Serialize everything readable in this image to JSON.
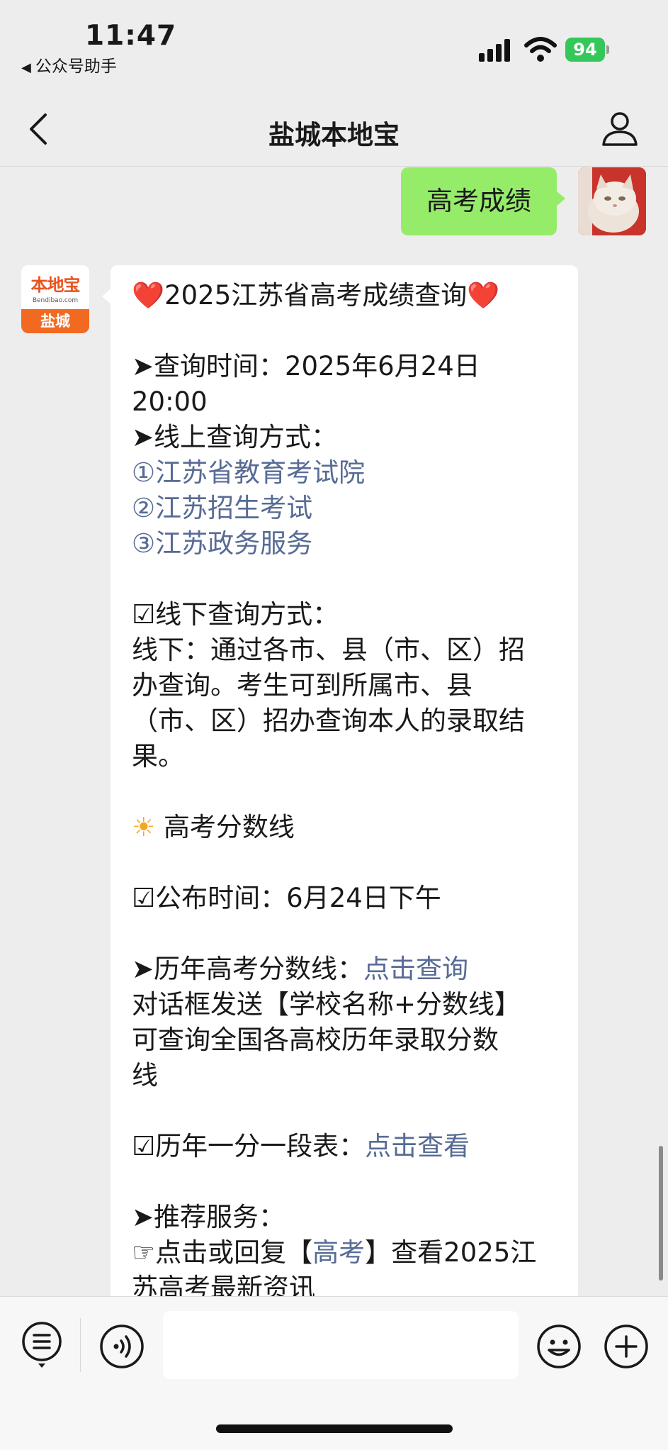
{
  "status_bar": {
    "time": "11:47",
    "back_app": "公众号助手",
    "battery": "94"
  },
  "nav": {
    "title": "盐城本地宝"
  },
  "sent_message": {
    "text": "高考成绩"
  },
  "sender": {
    "logo_text": "本地宝",
    "logo_url": "Bendibao.com",
    "logo_city": "盐城"
  },
  "message": {
    "title_heart_left": "❤️",
    "title": "2025江苏省高考成绩查询",
    "title_heart_right": "❤️",
    "query_time_label": "➤查询时间：2025年6月24日",
    "query_time_line2": "20:00",
    "online_label": "➤线上查询方式：",
    "online_links": [
      {
        "num": "①",
        "text": "江苏省教育考试院"
      },
      {
        "num": "②",
        "text": "江苏招生考试"
      },
      {
        "num": "③",
        "text": "江苏政务服务"
      }
    ],
    "offline_label": "☑线下查询方式：",
    "offline_lines": [
      "线下：通过各市、县（市、区）招",
      "办查询。考生可到所属市、县",
      "（市、区）招办查询本人的录取结",
      "果。"
    ],
    "score_line_icon": "☀",
    "score_line_title": "高考分数线",
    "publish_time": "☑公布时间：6月24日下午",
    "history_label": "➤历年高考分数线：",
    "history_link": "点击查询",
    "history_lines": [
      "对话框发送【学校名称+分数线】",
      "可查询全国各高校历年录取分数",
      "线"
    ],
    "rank_table_label": "☑历年一分一段表：",
    "rank_table_link": "点击查看",
    "recommend_label": "➤推荐服务：",
    "recommend_prefix": "☞点击或回复【",
    "recommend_link": "高考",
    "recommend_suffix": "】查看2025江",
    "recommend_line2": "苏高考最新资讯"
  },
  "colors": {
    "sent_bubble": "#95ec69",
    "link": "#576b95",
    "background": "#ededed",
    "brand_orange": "#f26a21"
  }
}
